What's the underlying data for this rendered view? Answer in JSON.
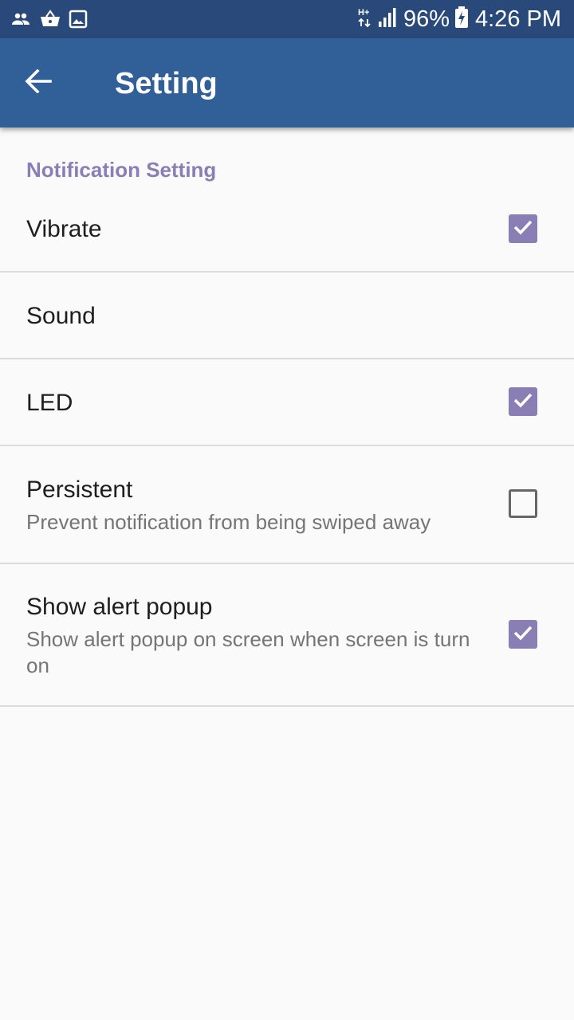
{
  "status_bar": {
    "battery": "96%",
    "time": "4:26 PM",
    "network": "H+"
  },
  "app_bar": {
    "title": "Setting"
  },
  "section": {
    "header": "Notification Setting"
  },
  "settings": [
    {
      "title": "Vibrate",
      "checked": true
    },
    {
      "title": "Sound"
    },
    {
      "title": "LED",
      "checked": true
    },
    {
      "title": "Persistent",
      "summary": "Prevent notification from being swiped away",
      "checked": false
    },
    {
      "title": "Show alert popup",
      "summary": "Show alert popup on screen when screen is turn on",
      "checked": true
    }
  ],
  "colors": {
    "status_bar": "#28497a",
    "app_bar": "#315f98",
    "accent": "#8a7fb4",
    "background": "#fafafa"
  }
}
